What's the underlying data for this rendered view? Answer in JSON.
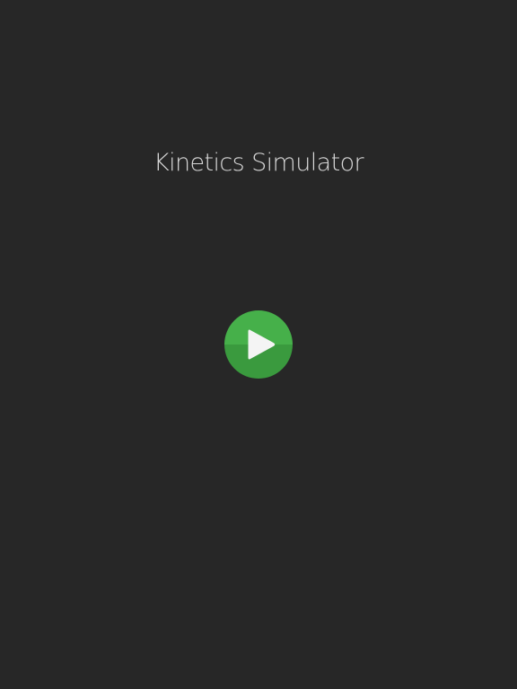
{
  "app": {
    "title": "Kinetics Simulator"
  },
  "play_button": {
    "icon": "play-icon",
    "color_top": "#46b04a",
    "color_bottom": "#3a9a3e"
  },
  "theme": {
    "background": "#272727",
    "title_color": "#d8d8d8"
  }
}
